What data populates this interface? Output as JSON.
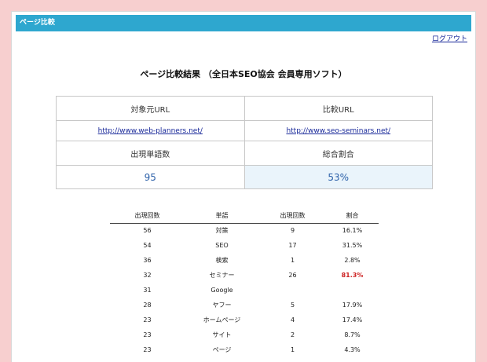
{
  "window": {
    "title": "ページ比較"
  },
  "header": {
    "logout_label": "ログアウト"
  },
  "main": {
    "heading": "ページ比較結果 （全日本SEO協会 会員専用ソフト）",
    "compare": {
      "source_label": "対象元URL",
      "target_label": "比較URL",
      "source_url": "http://www.web-planners.net/",
      "target_url": "http://www.seo-seminars.net/",
      "count_label": "出現単語数",
      "ratio_label": "総合割合",
      "count_value": "95",
      "ratio_value": "53%"
    },
    "words": {
      "headers": [
        "出現回数",
        "単語",
        "出現回数",
        "割合"
      ],
      "rows": [
        {
          "count1": "56",
          "word": "対策",
          "count2": "9",
          "ratio": "16.1%",
          "highlight": false
        },
        {
          "count1": "54",
          "word": "SEO",
          "count2": "17",
          "ratio": "31.5%",
          "highlight": false
        },
        {
          "count1": "36",
          "word": "検索",
          "count2": "1",
          "ratio": "2.8%",
          "highlight": false
        },
        {
          "count1": "32",
          "word": "セミナー",
          "count2": "26",
          "ratio": "81.3%",
          "highlight": true
        },
        {
          "count1": "31",
          "word": "Google",
          "count2": "",
          "ratio": "",
          "highlight": false
        },
        {
          "count1": "28",
          "word": "ヤフー",
          "count2": "5",
          "ratio": "17.9%",
          "highlight": false
        },
        {
          "count1": "23",
          "word": "ホームページ",
          "count2": "4",
          "ratio": "17.4%",
          "highlight": false
        },
        {
          "count1": "23",
          "word": "サイト",
          "count2": "2",
          "ratio": "8.7%",
          "highlight": false
        },
        {
          "count1": "23",
          "word": "ページ",
          "count2": "1",
          "ratio": "4.3%",
          "highlight": false
        }
      ]
    }
  },
  "colors": {
    "background": "#f7cfcf",
    "titlebar": "#2ea7cf",
    "highlight_cell": "#eaf4fb",
    "value_text": "#2a5fa8",
    "alert_text": "#cc1f1f"
  }
}
